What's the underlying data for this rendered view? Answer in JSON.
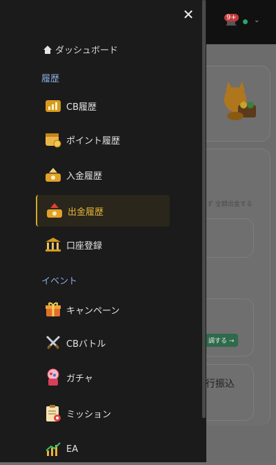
{
  "header": {
    "badge": "9+"
  },
  "background": {
    "text_all_withdraw": "全額出金する",
    "btn_label": "調する →",
    "bank_transfer": "行振込"
  },
  "drawer": {
    "close_label": "✕",
    "dashboard": "ダッシュボード",
    "sections": [
      {
        "title": "履歴",
        "items": [
          {
            "label": "CB履歴",
            "icon": "chart-icon"
          },
          {
            "label": "ポイント履歴",
            "icon": "calendar-coin-icon"
          },
          {
            "label": "入金履歴",
            "icon": "deposit-icon"
          },
          {
            "label": "出金履歴",
            "icon": "withdraw-icon",
            "active": true
          },
          {
            "label": "口座登録",
            "icon": "bank-icon"
          }
        ]
      },
      {
        "title": "イベント",
        "items": [
          {
            "label": "キャンペーン",
            "icon": "gift-icon"
          },
          {
            "label": "CBバトル",
            "icon": "swords-icon"
          },
          {
            "label": "ガチャ",
            "icon": "gacha-icon"
          },
          {
            "label": "ミッション",
            "icon": "mission-icon"
          },
          {
            "label": "EA",
            "icon": "ea-icon"
          }
        ]
      }
    ],
    "accent_color": "#d6a82a",
    "section_color": "#8fb0e6"
  }
}
